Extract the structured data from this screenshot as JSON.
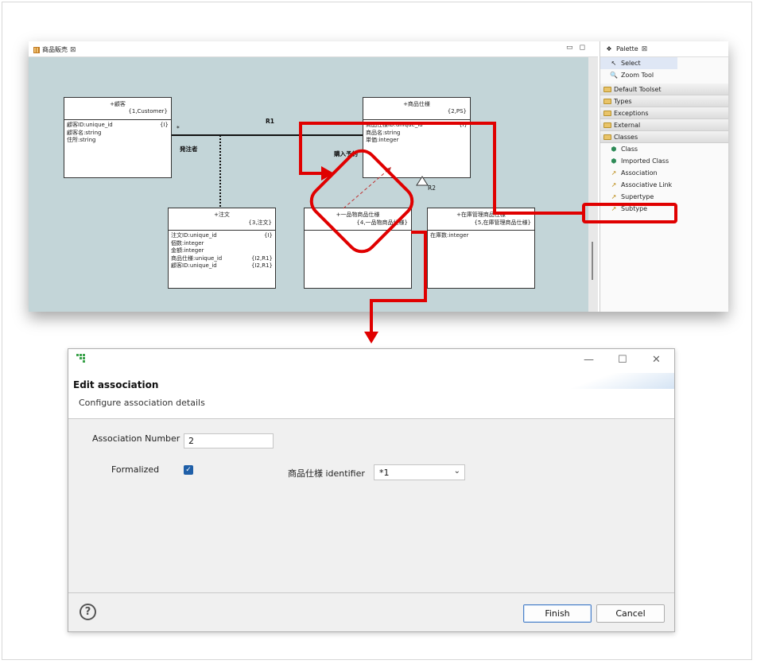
{
  "editor": {
    "tab_label": "商品販売",
    "tab_close": "⊠"
  },
  "palette": {
    "title": "Palette",
    "title_close": "⊠",
    "select": "Select",
    "zoom": "Zoom Tool",
    "drawers": [
      "Default Toolset",
      "Types",
      "Exceptions",
      "External",
      "Classes"
    ],
    "class_items": [
      "Class",
      "Imported Class",
      "Association",
      "Associative Link",
      "Supertype",
      "Subtype"
    ]
  },
  "diagram": {
    "customer": {
      "name": "+顧客",
      "key": "{1,Customer}",
      "attrs": [
        {
          "t": "顧客ID:unique_id",
          "r": "{I}"
        },
        {
          "t": "顧客名:string",
          "r": ""
        },
        {
          "t": "住所:string",
          "r": ""
        }
      ]
    },
    "spec": {
      "name": "+商品仕様",
      "key": "{2,PS}",
      "attrs": [
        {
          "t": "商品仕様ID:unique_id",
          "r": "{I}"
        },
        {
          "t": "商品名:string",
          "r": ""
        },
        {
          "t": "単価:integer",
          "r": ""
        }
      ]
    },
    "order": {
      "name": "+注文",
      "key": "{3,注文}",
      "attrs": [
        {
          "t": "注文ID:unique_id",
          "r": "{I}"
        },
        {
          "t": "個数:integer",
          "r": ""
        },
        {
          "t": "金額:integer",
          "r": ""
        },
        {
          "t": "商品仕様:unique_id",
          "r": "{I2,R1}"
        },
        {
          "t": "顧客ID:unique_id",
          "r": "{I2,R1}"
        }
      ]
    },
    "single": {
      "name": "+一品物商品仕様",
      "key": "{4,一品物商品仕様}",
      "attrs": []
    },
    "stock": {
      "name": "+在庫管理商品仕様",
      "key": "{5,在庫管理商品仕様}",
      "attrs": [
        {
          "t": "在庫数:integer",
          "r": ""
        }
      ]
    },
    "r1": "R1",
    "r2": "R2",
    "star": "*",
    "orderer": "発注者",
    "reserve": "購入予約"
  },
  "dialog": {
    "title": "Edit association",
    "subtitle": "Configure association details",
    "assoc_number_label": "Association Number",
    "assoc_number_value": "2",
    "formalized_label": "Formalized",
    "identifier_label": "商品仕様 identifier",
    "identifier_value": "*1",
    "finish": "Finish",
    "cancel": "Cancel",
    "help": "?"
  },
  "colors": {
    "highlight": "#e00000",
    "canvas": "#c3d5d8",
    "checkbox": "#1f5fa8"
  }
}
